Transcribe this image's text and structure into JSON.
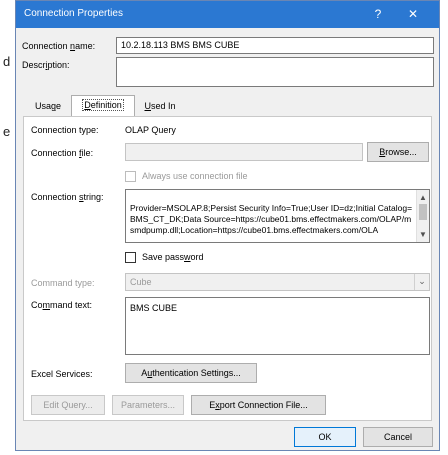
{
  "background": {
    "frag1": "d",
    "frag2": "e"
  },
  "window": {
    "title": "Connection Properties",
    "help_label": "?",
    "close_label": "✕"
  },
  "connection_name": {
    "label_pre": "Connection ",
    "label_key": "n",
    "label_post": "ame:",
    "value": "10.2.18.113 BMS BMS CUBE"
  },
  "description": {
    "label_pre": "Descr",
    "label_key": "i",
    "label_post": "ption:",
    "value": ""
  },
  "tabs": {
    "usage": {
      "pre": "Usa",
      "key": "g",
      "post": "e"
    },
    "definition": {
      "pre": "",
      "key": "D",
      "post": "efinition"
    },
    "used_in": {
      "pre": "",
      "key": "U",
      "post": "sed In"
    }
  },
  "definition": {
    "connection_type_label": "Connection type:",
    "connection_type_value": "OLAP Query",
    "connection_file": {
      "label_pre": "Connection ",
      "label_key": "f",
      "label_post": "ile:",
      "value": ""
    },
    "browse": {
      "pre": "",
      "key": "B",
      "post": "rowse..."
    },
    "always_use_file": "Always use connection file",
    "connection_string": {
      "label_pre": "Connection ",
      "label_key": "s",
      "label_post": "tring:",
      "value": "Provider=MSOLAP.8;Persist Security Info=True;User ID=dz;Initial Catalog=BMS_CT_DK;Data Source=https://cube01.bms.effectmakers.com/OLAP/msmdpump.dll;Location=https://cube01.bms.effectmakers.com/OLA"
    },
    "save_password": {
      "pre": "Save pass",
      "key": "w",
      "post": "ord"
    },
    "command_type": {
      "label": "Command type:",
      "value": "Cube"
    },
    "command_text": {
      "label_pre": "Co",
      "label_key": "m",
      "label_post": "mand text:",
      "value": "BMS CUBE"
    },
    "excel_services_label": "Excel Services:",
    "auth_settings": {
      "pre": "A",
      "key": "u",
      "post": "thentication Settings..."
    },
    "edit_query": "Edit Query...",
    "parameters": "Parameters...",
    "export": {
      "pre": "E",
      "key": "x",
      "post": "port Connection File..."
    }
  },
  "footer": {
    "ok": "OK",
    "cancel": "Cancel"
  }
}
